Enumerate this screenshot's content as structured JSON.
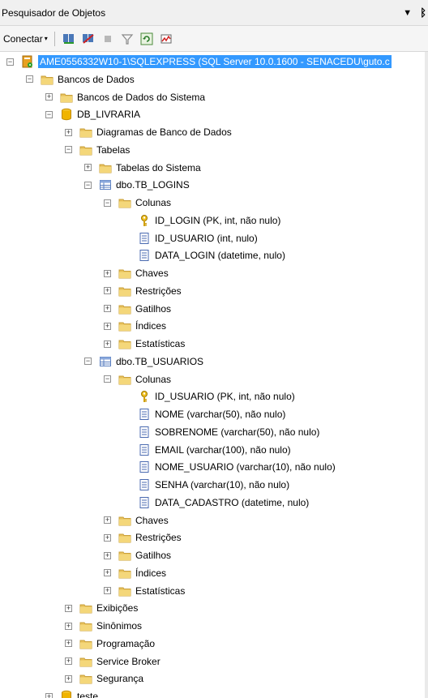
{
  "panel": {
    "title": "Pesquisador de Objetos",
    "pin_glyph": "▼",
    "pin_icon": "pin-icon"
  },
  "toolbar": {
    "connect_label": "Conectar",
    "connect_underline": "C",
    "connect_rest": "onectar"
  },
  "tree": {
    "server": "AME0556332W10-1\\SQLEXPRESS (SQL Server 10.0.1600 - SENACEDU\\guto.c",
    "bancos": "Bancos de Dados",
    "bancos_sistema": "Bancos de Dados do Sistema",
    "db_livraria": "DB_LIVRARIA",
    "diagramas": "Diagramas de Banco de Dados",
    "tabelas": "Tabelas",
    "tabelas_sistema": "Tabelas do Sistema",
    "tb_logins": "dbo.TB_LOGINS",
    "colunas1": "Colunas",
    "col_id_login": "ID_LOGIN (PK, int, não nulo)",
    "col_id_usuario": "ID_USUARIO (int, nulo)",
    "col_data_login": "DATA_LOGIN (datetime, nulo)",
    "chaves1": "Chaves",
    "restricoes1": "Restrições",
    "gatilhos1": "Gatilhos",
    "indices1": "Índices",
    "estatisticas1": "Estatísticas",
    "tb_usuarios": "dbo.TB_USUARIOS",
    "colunas2": "Colunas",
    "col_u_id": "ID_USUARIO (PK, int, não nulo)",
    "col_u_nome": "NOME (varchar(50), não nulo)",
    "col_u_sobrenome": "SOBRENOME (varchar(50), não nulo)",
    "col_u_email": "EMAIL (varchar(100), não nulo)",
    "col_u_nome_usuario": "NOME_USUARIO (varchar(10), não nulo)",
    "col_u_senha": "SENHA (varchar(10), não nulo)",
    "col_u_data_cadastro": "DATA_CADASTRO (datetime, nulo)",
    "chaves2": "Chaves",
    "restricoes2": "Restrições",
    "gatilhos2": "Gatilhos",
    "indices2": "Índices",
    "estatisticas2": "Estatísticas",
    "exibicoes": "Exibições",
    "sinonimos": "Sinônimos",
    "programacao": "Programação",
    "service_broker": "Service Broker",
    "seguranca": "Segurança",
    "teste": "teste"
  },
  "colors": {
    "folder": "#e8c15a",
    "folder_dark": "#c9a03b",
    "db": "#f0b400",
    "selection": "#3399ff",
    "table": "#5a7fc0",
    "key": "#e0b020"
  }
}
